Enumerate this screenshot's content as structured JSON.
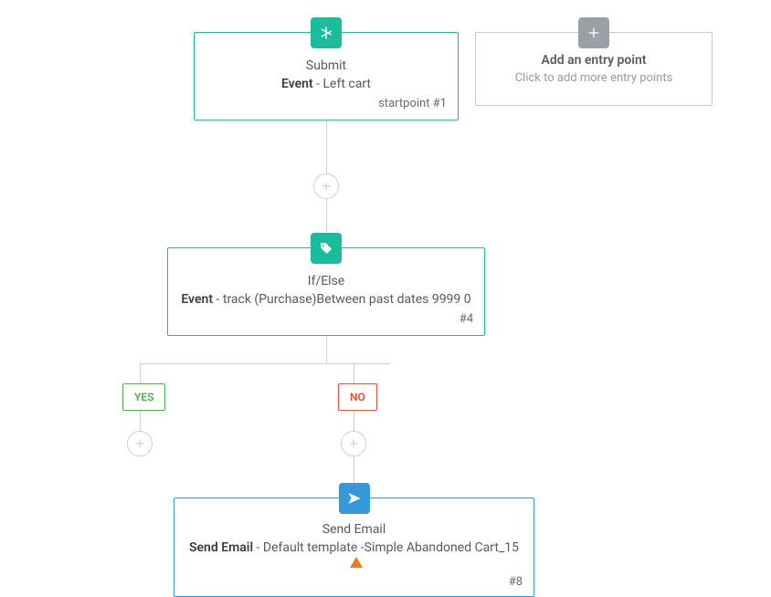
{
  "nodes": {
    "start": {
      "title": "Submit",
      "sub_bold": "Event",
      "sub_rest": " - Left cart",
      "id": "startpoint #1"
    },
    "addEntry": {
      "title": "Add an entry point",
      "subtitle": "Click to add more entry points"
    },
    "ifelse": {
      "title": "If/Else",
      "sub_bold": "Event",
      "sub_rest": " - track (Purchase)Between past dates 9999 0",
      "id": "#4"
    },
    "sendEmail": {
      "title": "Send Email",
      "sub_bold": "Send Email",
      "sub_rest": " - Default template -Simple Abandoned Cart_15",
      "id": "#8"
    }
  },
  "branches": {
    "yes": "YES",
    "no": "NO"
  }
}
